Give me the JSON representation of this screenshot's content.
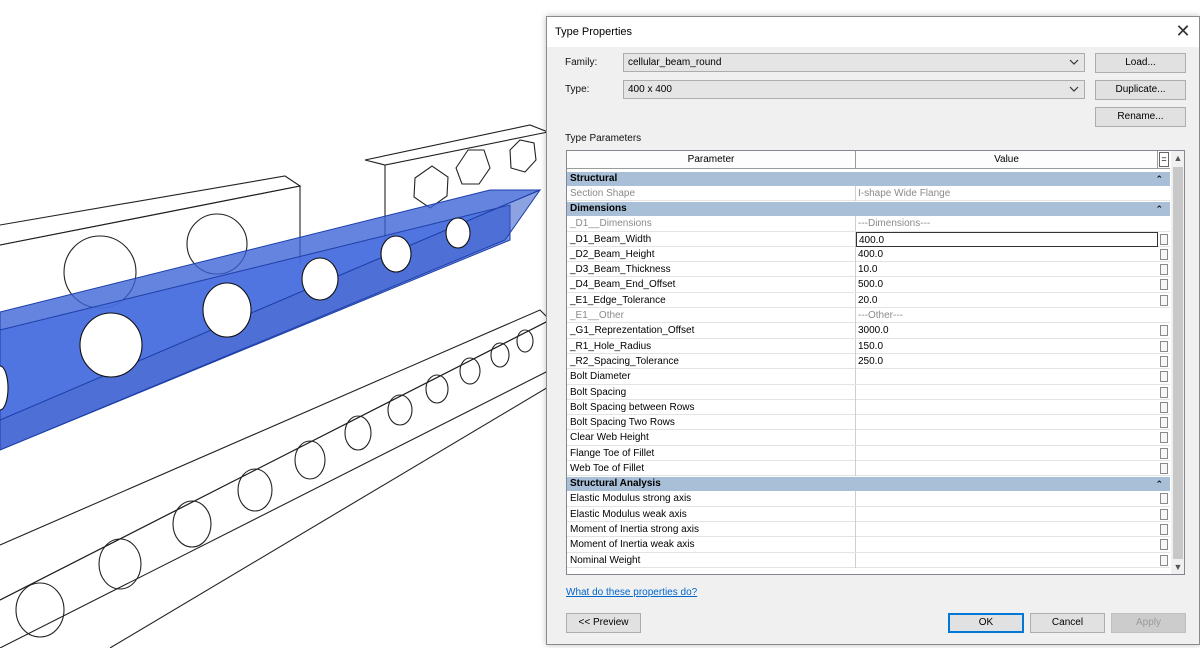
{
  "dialog": {
    "title": "Type Properties",
    "close_glyph": "✕",
    "family_label": "Family:",
    "family_value": "cellular_beam_round",
    "type_label": "Type:",
    "type_value": "400 x 400",
    "load_label": "Load...",
    "duplicate_label": "Duplicate...",
    "rename_label": "Rename...",
    "section_label": "Type Parameters",
    "help_link": "What do these properties do?",
    "preview_label": "<< Preview",
    "ok_label": "OK",
    "cancel_label": "Cancel",
    "apply_label": "Apply"
  },
  "table": {
    "col_parameter": "Parameter",
    "col_value": "Value",
    "col_menu": "=",
    "collapse_glyph": "⌃",
    "sections": [
      {
        "name": "Structural",
        "rows": [
          {
            "p": "Section Shape",
            "v": "I-shape Wide Flange",
            "dim": true
          }
        ]
      },
      {
        "name": "Dimensions",
        "rows": [
          {
            "p": "_D1__Dimensions",
            "v": "---Dimensions---",
            "dim": true
          },
          {
            "p": "_D1_Beam_Width",
            "v": "400.0",
            "sel": true
          },
          {
            "p": "_D2_Beam_Height",
            "v": "400.0"
          },
          {
            "p": "_D3_Beam_Thickness",
            "v": "10.0"
          },
          {
            "p": "_D4_Beam_End_Offset",
            "v": "500.0"
          },
          {
            "p": "_E1_Edge_Tolerance",
            "v": "20.0"
          },
          {
            "p": "_E1__Other",
            "v": "---Other---",
            "dim": true
          },
          {
            "p": "_G1_Reprezentation_Offset",
            "v": "3000.0"
          },
          {
            "p": "_R1_Hole_Radius",
            "v": "150.0"
          },
          {
            "p": "_R2_Spacing_Tolerance",
            "v": "250.0"
          },
          {
            "p": "Bolt Diameter",
            "v": ""
          },
          {
            "p": "Bolt Spacing",
            "v": ""
          },
          {
            "p": "Bolt Spacing between Rows",
            "v": ""
          },
          {
            "p": "Bolt Spacing Two Rows",
            "v": ""
          },
          {
            "p": "Clear Web Height",
            "v": ""
          },
          {
            "p": "Flange Toe of Fillet",
            "v": ""
          },
          {
            "p": "Web Toe of Fillet",
            "v": ""
          }
        ]
      },
      {
        "name": "Structural Analysis",
        "rows": [
          {
            "p": "Elastic Modulus strong axis",
            "v": ""
          },
          {
            "p": "Elastic Modulus weak axis",
            "v": ""
          },
          {
            "p": "Moment of Inertia strong axis",
            "v": ""
          },
          {
            "p": "Moment of Inertia weak axis",
            "v": ""
          },
          {
            "p": "Nominal Weight",
            "v": ""
          }
        ]
      }
    ]
  },
  "viewport": {
    "icon": "3d-beam-model",
    "highlight_color": "#3a62d6",
    "line_color": "#222222"
  }
}
